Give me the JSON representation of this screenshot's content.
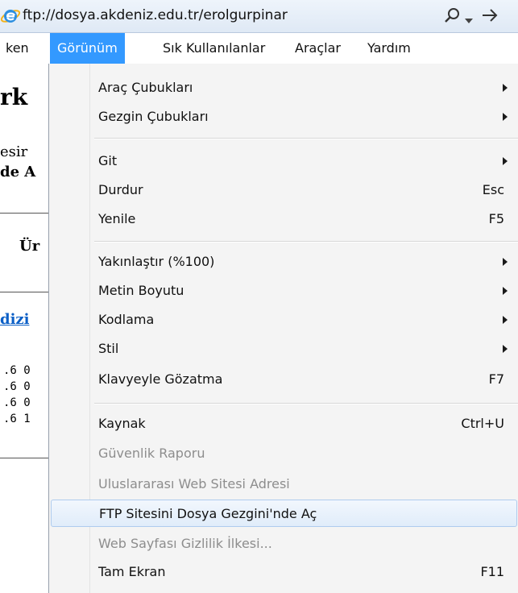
{
  "address_bar": {
    "url": "ftp://dosya.akdeniz.edu.tr/erolgurpinar",
    "search_icon": "search-icon",
    "go_icon": "go-arrow-icon"
  },
  "menubar": {
    "items": [
      {
        "label": "ken",
        "active": false
      },
      {
        "label": "Görünüm",
        "active": true
      },
      {
        "label": "Sık Kullanılanlar",
        "active": false
      },
      {
        "label": "Araçlar",
        "active": false
      },
      {
        "label": "Yardım",
        "active": false
      }
    ]
  },
  "page": {
    "heading": "rk",
    "text1": "esir",
    "text2": "de A",
    "text3": "Ür",
    "link": "dizi",
    "rows": [
      ".6 0",
      ".6 0",
      ".6 0",
      ".6 1"
    ]
  },
  "menu": {
    "items": [
      {
        "label": "Araç Çubukları",
        "submenu": true
      },
      {
        "label": "Gezgin Çubukları",
        "submenu": true
      },
      {
        "label": "Git",
        "submenu": true
      },
      {
        "label": "Durdur",
        "shortcut": "Esc"
      },
      {
        "label": "Yenile",
        "shortcut": "F5"
      },
      {
        "label": "Yakınlaştır (%100)",
        "submenu": true
      },
      {
        "label": "Metin Boyutu",
        "submenu": true
      },
      {
        "label": "Kodlama",
        "submenu": true
      },
      {
        "label": "Stil",
        "submenu": true
      },
      {
        "label": "Klavyeyle Gözatma",
        "shortcut": "F7"
      },
      {
        "label": "Kaynak",
        "shortcut": "Ctrl+U"
      },
      {
        "label": "Güvenlik Raporu",
        "disabled": true
      },
      {
        "label": "Uluslararası Web Sitesi Adresi",
        "disabled": true
      },
      {
        "label": "FTP Sitesini Dosya Gezgini'nde Aç",
        "highlighted": true
      },
      {
        "label": "Web Sayfası Gizlilik İlkesi...",
        "disabled": true
      },
      {
        "label": "Tam Ekran",
        "shortcut": "F11"
      }
    ]
  },
  "colors": {
    "menubar_active": "#3399ff",
    "menu_background": "#f4f4f4",
    "disabled_text": "#8d8d8d",
    "link": "#0b5fc6"
  }
}
